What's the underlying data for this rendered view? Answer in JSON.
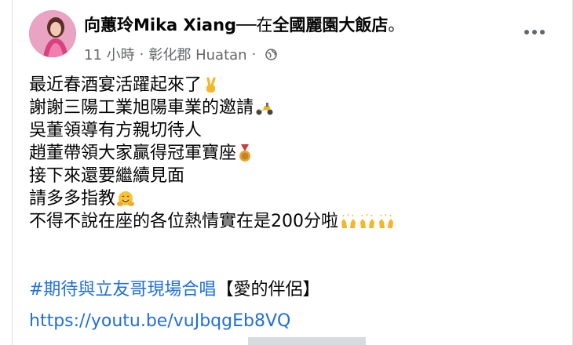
{
  "post": {
    "author": "向蕙玲Mika Xiang",
    "separator": "──",
    "at_prefix": "在",
    "place": "全國麗園大飯店",
    "end_mark": "。",
    "time": "11 小時",
    "location": "彰化郡 Huatan",
    "meta_separator": "·",
    "privacy_icon": "globe-icon",
    "more_icon": "more-options-icon",
    "lines": [
      {
        "text": "最近春酒宴活躍起來了",
        "emoji": "victory-hand-emoji"
      },
      {
        "text": "謝謝三陽工業旭陽車業的邀請",
        "emoji": "motor-scooter-emoji"
      },
      {
        "text": "吳董領導有方親切待人",
        "emoji": ""
      },
      {
        "text": "趙董帶領大家贏得冠軍寶座",
        "emoji": "medal-emoji"
      },
      {
        "text": "接下來還要繼續見面",
        "emoji": ""
      },
      {
        "text": "請多多指教",
        "emoji": "hugging-face-emoji"
      },
      {
        "text": "不得不說在座的各位熱情實在是200分啦",
        "emoji": "raising-hands-emoji-x3"
      }
    ],
    "hashtag": "#期待與立友哥現場合唱",
    "hashtag_suffix": "【愛的伴侶】",
    "link": "https://youtu.be/vuJbqgEb8VQ"
  },
  "colors": {
    "text": "#050505",
    "secondary": "#65676b",
    "link": "#216fdb",
    "avatar": "#e88bb4"
  }
}
